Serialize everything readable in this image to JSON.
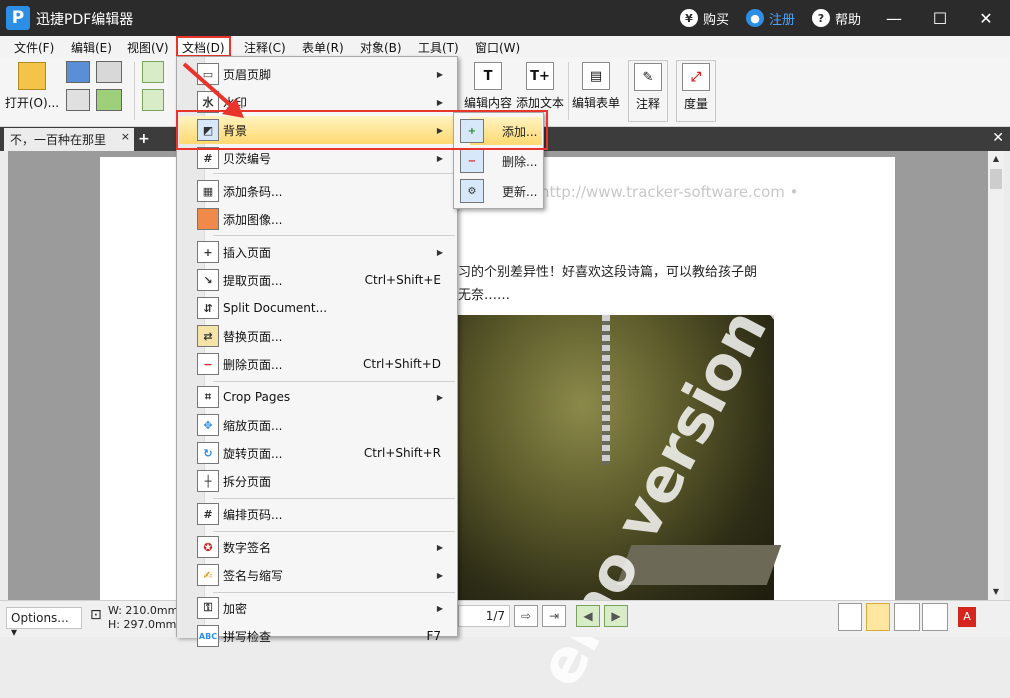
{
  "app": {
    "title": "迅捷PDF编辑器",
    "logo": "P",
    "buy": "购买",
    "register": "注册",
    "help": "帮助"
  },
  "menubar": [
    "文件(F)",
    "编辑(E)",
    "视图(V)",
    "文档(D)",
    "注释(C)",
    "表单(R)",
    "对象(B)",
    "工具(T)",
    "窗口(W)"
  ],
  "toolbar": {
    "open": "打开(O)...",
    "edit_content": "编辑内容",
    "add_text": "添加文本",
    "edit_form": "编辑表单",
    "annotate": "注释",
    "measure": "度量"
  },
  "tab": {
    "title": "不，一百种在那里",
    "close": "×",
    "add": "+"
  },
  "document_menu": {
    "header_footer": "页眉页脚",
    "watermark": "水印",
    "background": "背景",
    "bates": "贝茨编号",
    "add_barcode": "添加条码...",
    "add_image": "添加图像...",
    "insert_pages": "插入页面",
    "extract_pages": "提取页面...",
    "extract_shortcut": "Ctrl+Shift+E",
    "split_document": "Split Document...",
    "replace_pages": "替换页面...",
    "delete_pages": "删除页面...",
    "delete_shortcut": "Ctrl+Shift+D",
    "crop_pages": "Crop Pages",
    "resize_pages": "缩放页面...",
    "rotate_pages": "旋转页面...",
    "rotate_shortcut": "Ctrl+Shift+R",
    "split_pages": "拆分页面",
    "number_pages": "编排页码...",
    "digital_signature": "数字签名",
    "sign_initials": "签名与缩写",
    "encrypt": "加密",
    "spell_check": "拼写检查",
    "spell_shortcut": "F7"
  },
  "background_submenu": {
    "add": "添加...",
    "delete": "删除...",
    "update": "更新..."
  },
  "page_content": {
    "url": "http://www.tracker-software.com •",
    "line1": "习的个别差异性！好喜欢这段诗篇，可以教给孩子朗",
    "line2": "无奈……",
    "watermark": "emo version)"
  },
  "statusbar": {
    "options": "Options...",
    "width": "W: 210.0mm",
    "height": "H: 297.0mm",
    "page": "1/7"
  },
  "colors": {
    "titlebar": "#2b2b2b",
    "highlight": "#ffd971",
    "annotation_red": "#e8342a",
    "accent": "#2d8ee6"
  }
}
